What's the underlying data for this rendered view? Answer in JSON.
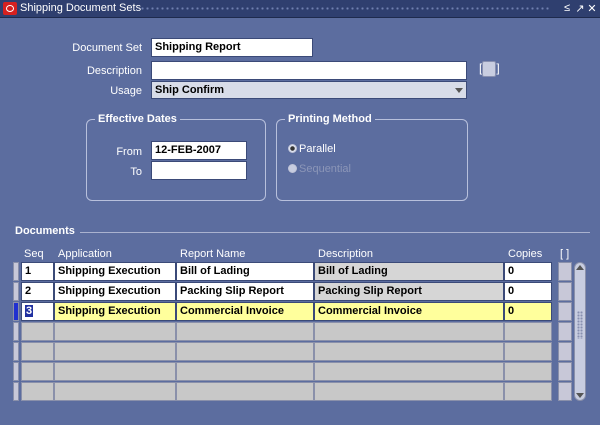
{
  "window": {
    "title": "Shipping Document Sets",
    "controls": [
      "≤",
      "↗",
      "✕"
    ]
  },
  "header": {
    "document_set_label": "Document Set",
    "document_set_value": "Shipping Report",
    "description_label": "Description",
    "description_value": "",
    "usage_label": "Usage",
    "usage_value": "Ship Confirm",
    "flex_button": "[ ]"
  },
  "effective_dates": {
    "title": "Effective Dates",
    "from_label": "From",
    "from_value": "12-FEB-2007",
    "to_label": "To",
    "to_value": ""
  },
  "printing_method": {
    "title": "Printing Method",
    "options": [
      {
        "label": "Parallel",
        "selected": true
      },
      {
        "label": "Sequential",
        "selected": false
      }
    ]
  },
  "documents": {
    "title": "Documents",
    "headers": {
      "seq": "Seq",
      "application": "Application",
      "report_name": "Report Name",
      "description": "Description",
      "copies": "Copies",
      "flex": "[ ]"
    },
    "rows": [
      {
        "seq": "1",
        "application": "Shipping Execution",
        "report_name": "Bill of Lading",
        "description": "Bill of Lading",
        "copies": "0"
      },
      {
        "seq": "2",
        "application": "Shipping Execution",
        "report_name": "Packing Slip Report",
        "description": "Packing Slip Report",
        "copies": "0"
      },
      {
        "seq": "3",
        "application": "Shipping Execution",
        "report_name": "Commercial Invoice",
        "description": "Commercial Invoice",
        "copies": "0"
      }
    ]
  }
}
